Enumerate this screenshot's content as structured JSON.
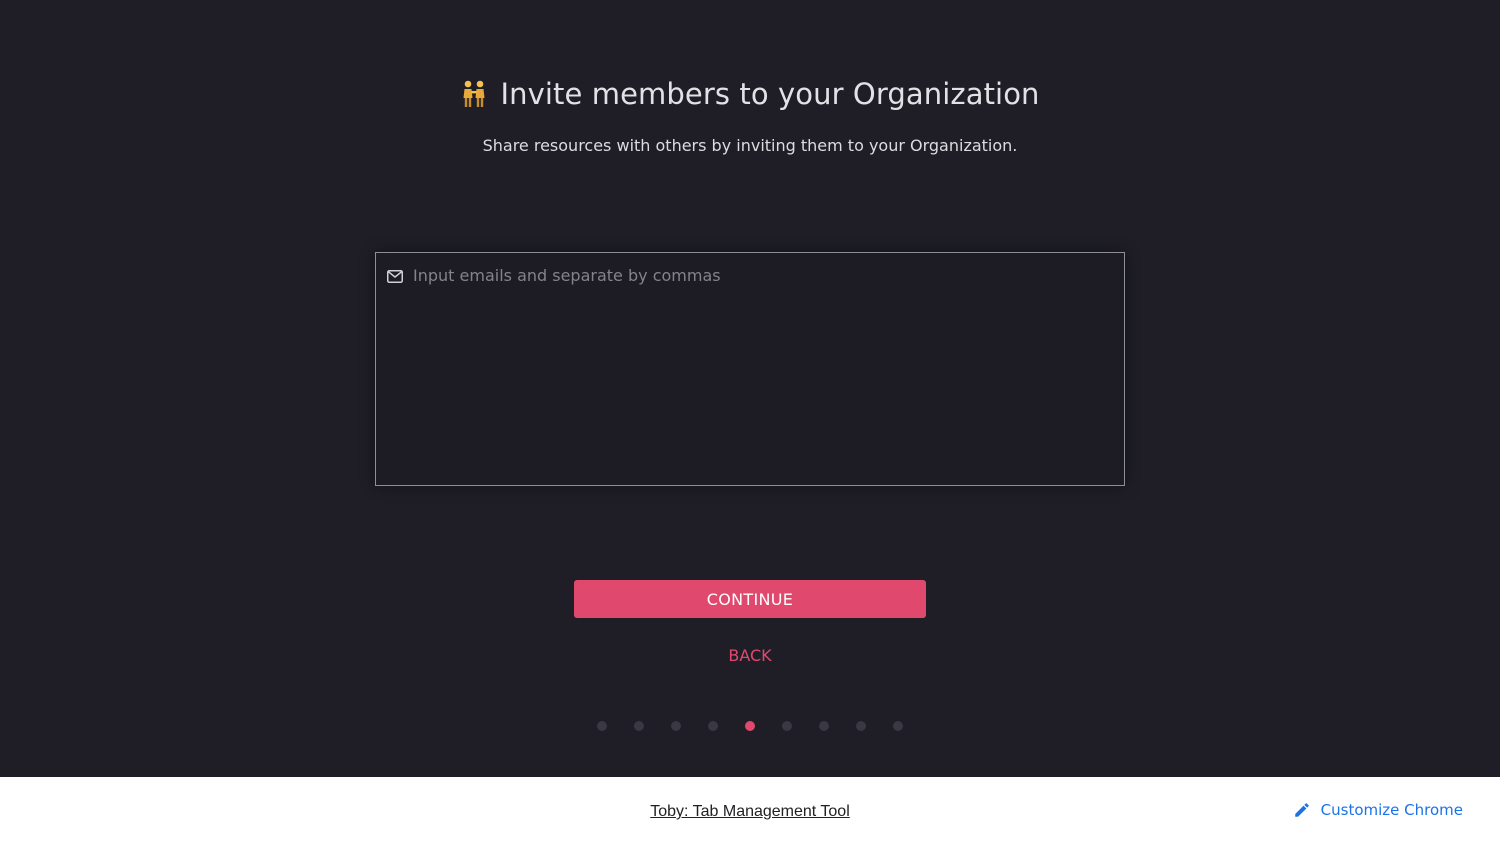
{
  "header": {
    "title": "Invite members to your Organization",
    "subtitle": "Share resources with others by inviting them to your Organization.",
    "icon": "people-holding-hands-icon"
  },
  "invite": {
    "value": "",
    "placeholder": "Input emails and separate by commas",
    "icon": "mail-icon"
  },
  "actions": {
    "continue_label": "CONTINUE",
    "back_label": "BACK"
  },
  "progress": {
    "total_steps": 9,
    "current_step": 5
  },
  "footer": {
    "link_text": "Toby: Tab Management Tool",
    "customize_label": "Customize Chrome",
    "customize_icon": "pencil-icon"
  },
  "colors": {
    "background": "#1f1e27",
    "accent": "#e1486e",
    "text": "#e2e2e6",
    "link": "#1a73e8"
  }
}
